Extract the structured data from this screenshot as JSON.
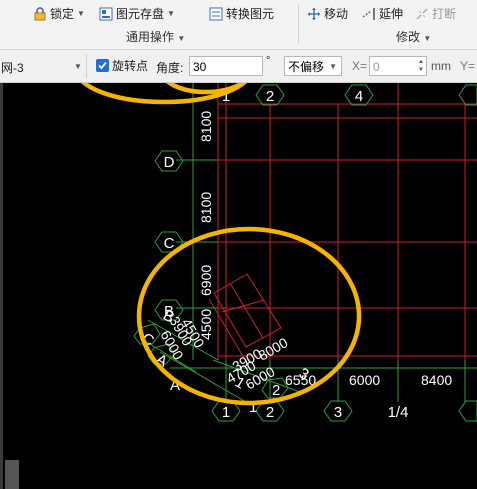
{
  "ribbon": {
    "lock_label": "锁定",
    "save_element_label": "图元存盘",
    "convert_element_label": "转换图元",
    "move_label": "移动",
    "extend_label": "延伸",
    "break_label": "打断",
    "group_general_label": "通用操作",
    "group_modify_label": "修改"
  },
  "toolbar": {
    "layer_value": "网-3",
    "rotate_point_label": "旋转点",
    "angle_label": "角度:",
    "angle_value": "30",
    "degree_unit": "°",
    "offset_value": "不偏移",
    "x_label": "X=",
    "x_value": "0",
    "unit_mm": "mm",
    "y_label": "Y="
  },
  "grid": {
    "axis_top": [
      "1",
      "2",
      "4"
    ],
    "axis_bottom": [
      "1",
      "2",
      "3",
      "1/4"
    ],
    "axis_left": [
      "D",
      "C",
      "B"
    ],
    "dims_vertical": [
      "8100",
      "8100",
      "6900",
      "4500"
    ],
    "dims_horizontal": [
      "6550",
      "6000",
      "8400"
    ],
    "rotated_axis_labels": [
      "C",
      "B",
      "A",
      "1",
      "2",
      "3"
    ],
    "rotated_dims": [
      "3900",
      "6000",
      "4500",
      "4700",
      "3900",
      "8000",
      "6000"
    ],
    "rotated_partial_label": "A"
  },
  "colors": {
    "canvas_bg": "#000000",
    "grid_red": "#cc1f2b",
    "axis_green": "#2f9e3a",
    "label_white": "#ffffff",
    "highlight": "#f5b400",
    "check_blue": "#1e6fd9"
  }
}
